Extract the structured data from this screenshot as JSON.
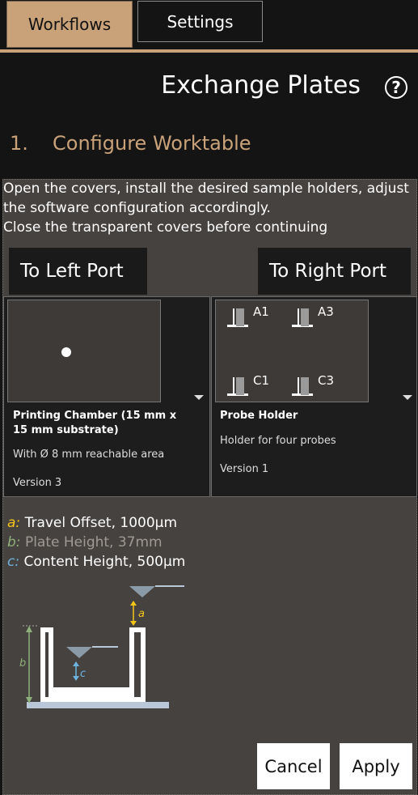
{
  "tabs": [
    {
      "label": "Workflows",
      "active": true
    },
    {
      "label": "Settings",
      "active": false
    }
  ],
  "header": {
    "title": "Exchange Plates",
    "help_symbol": "?"
  },
  "step": {
    "number": "1.",
    "title": "Configure Worktable"
  },
  "instructions": {
    "line1": "Open the covers, install the desired sample holders, adjust the software configuration accordingly.",
    "line2": "Close the transparent covers before continuing"
  },
  "ports": {
    "left_label": "To Left Port",
    "right_label": "To Right Port"
  },
  "left_card": {
    "title": "Printing Chamber (15 mm x 15 mm substrate)",
    "description": "With Ø 8 mm reachable area",
    "version": "Version 3"
  },
  "right_card": {
    "title": "Probe Holder",
    "description": "Holder for four probes",
    "version": "Version 1",
    "slots": [
      "A1",
      "A3",
      "C1",
      "C3"
    ]
  },
  "legend": [
    {
      "key": "a:",
      "text": "Travel Offset, 1000µm",
      "color": "#f5c518",
      "text_color": "#ffffff"
    },
    {
      "key": "b:",
      "text": "Plate Height, 37mm",
      "color": "#8fb07a",
      "text_color": "#a09a94"
    },
    {
      "key": "c:",
      "text": "Content Height, 500µm",
      "color": "#6fb4e0",
      "text_color": "#ffffff"
    }
  ],
  "diagram_labels": {
    "a": "a",
    "b": "b",
    "c": "c"
  },
  "actions": {
    "cancel_label": "Cancel",
    "apply_label": "Apply"
  },
  "colors": {
    "accent": "#c9a27a",
    "panel": "#454240",
    "card": "#1d1d1d"
  }
}
